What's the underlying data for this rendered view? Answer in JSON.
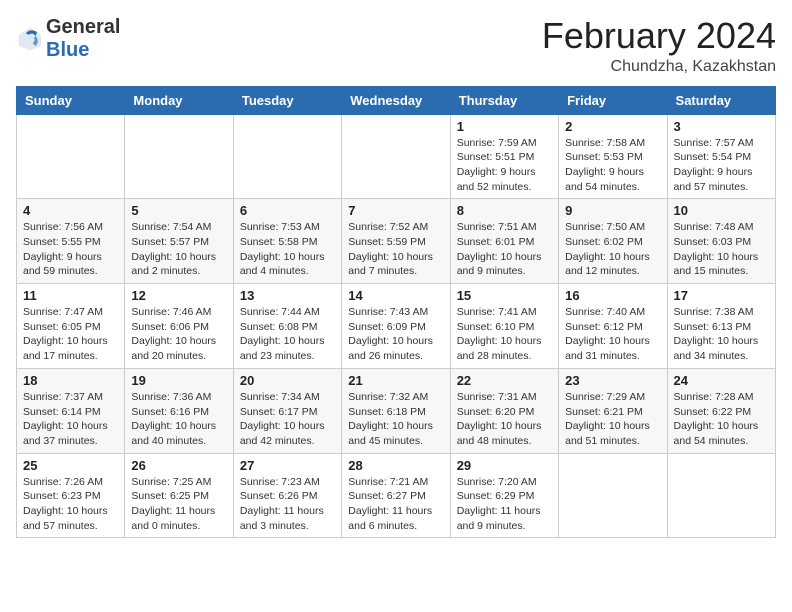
{
  "header": {
    "logo_general": "General",
    "logo_blue": "Blue",
    "month_year": "February 2024",
    "location": "Chundzha, Kazakhstan"
  },
  "days_of_week": [
    "Sunday",
    "Monday",
    "Tuesday",
    "Wednesday",
    "Thursday",
    "Friday",
    "Saturday"
  ],
  "weeks": [
    [
      {
        "day": "",
        "info": ""
      },
      {
        "day": "",
        "info": ""
      },
      {
        "day": "",
        "info": ""
      },
      {
        "day": "",
        "info": ""
      },
      {
        "day": "1",
        "info": "Sunrise: 7:59 AM\nSunset: 5:51 PM\nDaylight: 9 hours\nand 52 minutes."
      },
      {
        "day": "2",
        "info": "Sunrise: 7:58 AM\nSunset: 5:53 PM\nDaylight: 9 hours\nand 54 minutes."
      },
      {
        "day": "3",
        "info": "Sunrise: 7:57 AM\nSunset: 5:54 PM\nDaylight: 9 hours\nand 57 minutes."
      }
    ],
    [
      {
        "day": "4",
        "info": "Sunrise: 7:56 AM\nSunset: 5:55 PM\nDaylight: 9 hours\nand 59 minutes."
      },
      {
        "day": "5",
        "info": "Sunrise: 7:54 AM\nSunset: 5:57 PM\nDaylight: 10 hours\nand 2 minutes."
      },
      {
        "day": "6",
        "info": "Sunrise: 7:53 AM\nSunset: 5:58 PM\nDaylight: 10 hours\nand 4 minutes."
      },
      {
        "day": "7",
        "info": "Sunrise: 7:52 AM\nSunset: 5:59 PM\nDaylight: 10 hours\nand 7 minutes."
      },
      {
        "day": "8",
        "info": "Sunrise: 7:51 AM\nSunset: 6:01 PM\nDaylight: 10 hours\nand 9 minutes."
      },
      {
        "day": "9",
        "info": "Sunrise: 7:50 AM\nSunset: 6:02 PM\nDaylight: 10 hours\nand 12 minutes."
      },
      {
        "day": "10",
        "info": "Sunrise: 7:48 AM\nSunset: 6:03 PM\nDaylight: 10 hours\nand 15 minutes."
      }
    ],
    [
      {
        "day": "11",
        "info": "Sunrise: 7:47 AM\nSunset: 6:05 PM\nDaylight: 10 hours\nand 17 minutes."
      },
      {
        "day": "12",
        "info": "Sunrise: 7:46 AM\nSunset: 6:06 PM\nDaylight: 10 hours\nand 20 minutes."
      },
      {
        "day": "13",
        "info": "Sunrise: 7:44 AM\nSunset: 6:08 PM\nDaylight: 10 hours\nand 23 minutes."
      },
      {
        "day": "14",
        "info": "Sunrise: 7:43 AM\nSunset: 6:09 PM\nDaylight: 10 hours\nand 26 minutes."
      },
      {
        "day": "15",
        "info": "Sunrise: 7:41 AM\nSunset: 6:10 PM\nDaylight: 10 hours\nand 28 minutes."
      },
      {
        "day": "16",
        "info": "Sunrise: 7:40 AM\nSunset: 6:12 PM\nDaylight: 10 hours\nand 31 minutes."
      },
      {
        "day": "17",
        "info": "Sunrise: 7:38 AM\nSunset: 6:13 PM\nDaylight: 10 hours\nand 34 minutes."
      }
    ],
    [
      {
        "day": "18",
        "info": "Sunrise: 7:37 AM\nSunset: 6:14 PM\nDaylight: 10 hours\nand 37 minutes."
      },
      {
        "day": "19",
        "info": "Sunrise: 7:36 AM\nSunset: 6:16 PM\nDaylight: 10 hours\nand 40 minutes."
      },
      {
        "day": "20",
        "info": "Sunrise: 7:34 AM\nSunset: 6:17 PM\nDaylight: 10 hours\nand 42 minutes."
      },
      {
        "day": "21",
        "info": "Sunrise: 7:32 AM\nSunset: 6:18 PM\nDaylight: 10 hours\nand 45 minutes."
      },
      {
        "day": "22",
        "info": "Sunrise: 7:31 AM\nSunset: 6:20 PM\nDaylight: 10 hours\nand 48 minutes."
      },
      {
        "day": "23",
        "info": "Sunrise: 7:29 AM\nSunset: 6:21 PM\nDaylight: 10 hours\nand 51 minutes."
      },
      {
        "day": "24",
        "info": "Sunrise: 7:28 AM\nSunset: 6:22 PM\nDaylight: 10 hours\nand 54 minutes."
      }
    ],
    [
      {
        "day": "25",
        "info": "Sunrise: 7:26 AM\nSunset: 6:23 PM\nDaylight: 10 hours\nand 57 minutes."
      },
      {
        "day": "26",
        "info": "Sunrise: 7:25 AM\nSunset: 6:25 PM\nDaylight: 11 hours\nand 0 minutes."
      },
      {
        "day": "27",
        "info": "Sunrise: 7:23 AM\nSunset: 6:26 PM\nDaylight: 11 hours\nand 3 minutes."
      },
      {
        "day": "28",
        "info": "Sunrise: 7:21 AM\nSunset: 6:27 PM\nDaylight: 11 hours\nand 6 minutes."
      },
      {
        "day": "29",
        "info": "Sunrise: 7:20 AM\nSunset: 6:29 PM\nDaylight: 11 hours\nand 9 minutes."
      },
      {
        "day": "",
        "info": ""
      },
      {
        "day": "",
        "info": ""
      }
    ]
  ]
}
